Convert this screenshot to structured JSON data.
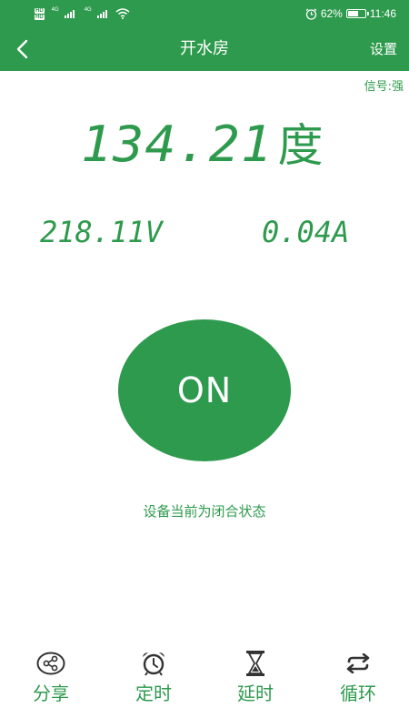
{
  "status_bar": {
    "net_badge": "HD",
    "net_gen": "4G",
    "battery_percent": "62%",
    "battery_level": 0.62,
    "time": "11:46",
    "icons": [
      "hd-icon",
      "signal-icon",
      "wifi-icon",
      "alarm-icon",
      "battery-icon"
    ]
  },
  "header": {
    "title": "开水房",
    "settings_label": "设置",
    "back_icon": "chevron-left-icon"
  },
  "signal": {
    "text": "信号:强"
  },
  "meter": {
    "energy_value": "134.21",
    "energy_unit": "度",
    "voltage": "218.11V",
    "current": "0.04A"
  },
  "power": {
    "label": "ON",
    "state_text": "设备当前为闭合状态"
  },
  "actions": [
    {
      "label": "分享",
      "icon": "share-icon"
    },
    {
      "label": "定时",
      "icon": "alarm-clock-icon"
    },
    {
      "label": "延时",
      "icon": "hourglass-icon"
    },
    {
      "label": "循环",
      "icon": "loop-icon"
    }
  ],
  "colors": {
    "primary": "#2e9a4d",
    "background": "#ffffff",
    "icon_dark": "#333333"
  }
}
